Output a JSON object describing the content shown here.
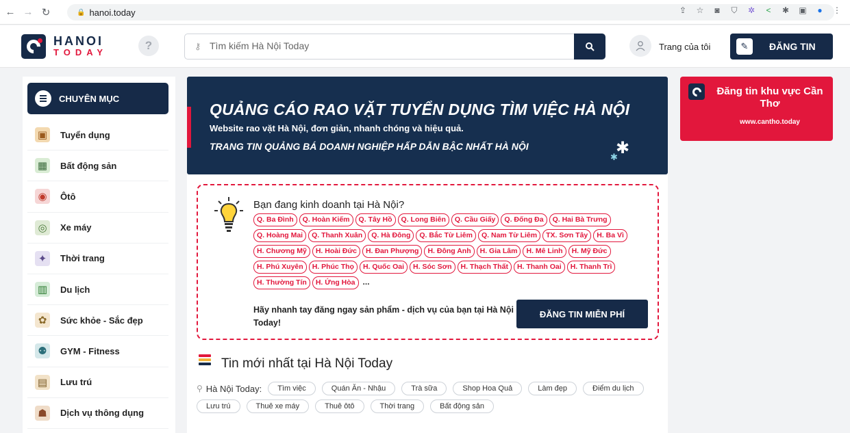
{
  "browser": {
    "url": "hanoi.today"
  },
  "header": {
    "logo_line1": "HANOI",
    "logo_line2": "TODAY",
    "help_symbol": "?",
    "search_placeholder": "Tìm kiếm Hà Nội Today",
    "user_label": "Trang của tôi",
    "post_button": "ĐĂNG TIN"
  },
  "sidebar": {
    "title": "CHUYÊN MỤC",
    "items": [
      {
        "label": "Tuyển dụng",
        "icon": "briefcase-icon"
      },
      {
        "label": "Bất động sản",
        "icon": "building-icon"
      },
      {
        "label": "Ôtô",
        "icon": "car-icon"
      },
      {
        "label": "Xe máy",
        "icon": "motorbike-icon"
      },
      {
        "label": "Thời trang",
        "icon": "fashion-icon"
      },
      {
        "label": "Du lịch",
        "icon": "travel-icon"
      },
      {
        "label": "Sức khỏe - Sắc đẹp",
        "icon": "beauty-icon"
      },
      {
        "label": "GYM - Fitness",
        "icon": "dumbbell-icon"
      },
      {
        "label": "Lưu trú",
        "icon": "hotel-icon"
      },
      {
        "label": "Dịch vụ thông dụng",
        "icon": "service-icon"
      }
    ]
  },
  "banner": {
    "title": "QUẢNG CÁO RAO VẶT TUYỂN DỤNG TÌM VIỆC HÀ NỘI",
    "subtitle": "Website rao vặt Hà Nội, đơn giản, nhanh chóng và hiệu quả.",
    "tagline": "TRANG TIN QUẢNG BÁ DOANH NGHIỆP HẤP DẪN BẬC NHẤT HÀ NỘI"
  },
  "promo": {
    "title": "Bạn đang kinh doanh tại Hà Nội?",
    "districts": [
      "Q. Ba Đình",
      "Q. Hoàn Kiếm",
      "Q. Tây Hồ",
      "Q. Long Biên",
      "Q. Cầu Giấy",
      "Q. Đống Đa",
      "Q. Hai Bà Trưng",
      "Q. Hoàng Mai",
      "Q. Thanh Xuân",
      "Q. Hà Đông",
      "Q. Bắc Từ Liêm",
      "Q. Nam Từ Liêm",
      "TX. Sơn Tây",
      "H. Ba Vì",
      "H. Chương Mỹ",
      "H. Hoài Đức",
      "H. Đan Phượng",
      "H. Đông Anh",
      "H. Gia Lâm",
      "H. Mê Linh",
      "H. Mỹ Đức",
      "H. Phú Xuyên",
      "H. Phúc Thọ",
      "H. Quốc Oai",
      "H. Sóc Sơn",
      "H. Thạch Thất",
      "H. Thanh Oai",
      "H. Thanh Trì",
      "H. Thường Tín",
      "H. Ứng Hòa"
    ],
    "more": "...",
    "cta_text": "Hãy nhanh tay đăng ngay sản phẩm - dịch vụ của bạn tại Hà Nội Today!",
    "cta_button": "ĐĂNG TIN MIỄN PHÍ"
  },
  "latest": {
    "title": "Tin mới nhất tại Hà Nội Today",
    "location_label": "Hà Nội Today:",
    "chips": [
      "Tìm việc",
      "Quán Ăn - Nhậu",
      "Trà sữa",
      "Shop Hoa Quả",
      "Làm đẹp",
      "Điểm du lịch",
      "Lưu trú",
      "Thuê xe máy",
      "Thuê ôtô",
      "Thời trang",
      "Bất động sản"
    ]
  },
  "right_ad": {
    "title": "Đăng tin khu vực Cần Thơ",
    "url": "www.cantho.today"
  },
  "colors": {
    "navy": "#162a48",
    "red": "#e2173c"
  }
}
